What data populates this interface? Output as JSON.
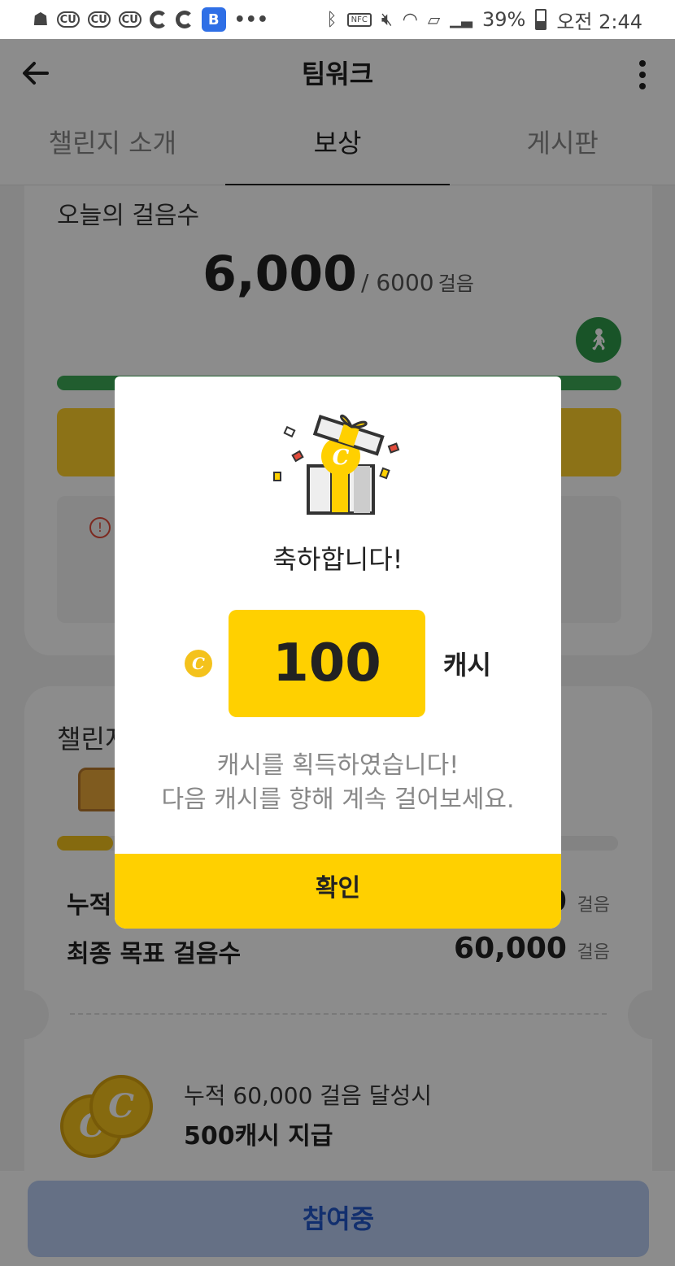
{
  "status_bar": {
    "left_icons": [
      "carrier-icon",
      "cu-icon",
      "cu-icon",
      "cu-icon",
      "c-app-icon",
      "c-app-icon",
      "b-app-icon",
      "more-dots-icon"
    ],
    "cu_label": "CU",
    "b_label": "B",
    "nfc_label": "NFC",
    "battery": "39%",
    "time": "오전 2:44"
  },
  "app_bar": {
    "title": "팀워크"
  },
  "tabs": [
    {
      "label": "챌린지 소개",
      "active": false
    },
    {
      "label": "보상",
      "active": true
    },
    {
      "label": "게시판",
      "active": false
    }
  ],
  "today": {
    "label": "오늘의 걸음수",
    "steps": "6,000",
    "goal": "/ 6000",
    "unit": "걸음",
    "progress": 1.0
  },
  "challenge": {
    "label_partial": "챌린지",
    "progress": 0.1,
    "cumulative_label_partial": "누적",
    "cumulative_value_partial": "0",
    "unit": "걸음",
    "final_goal_label": "최종 목표 걸음수",
    "final_goal_value": "60,000",
    "reward_condition": "누적 60,000 걸음 달성시",
    "reward_amount": "500캐시 지급"
  },
  "bottom_button": {
    "label": "참여중"
  },
  "dialog": {
    "title": "축하합니다!",
    "cash_value": "100",
    "cash_unit": "캐시",
    "coin_letter": "C",
    "message_line1": "캐시를 획득하였습니다!",
    "message_line2": "다음 캐시를 향해 계속 걸어보세요.",
    "confirm_label": "확인"
  },
  "colors": {
    "accent_yellow": "#ffd000",
    "green": "#3caa56",
    "join_text": "#2257c9"
  }
}
